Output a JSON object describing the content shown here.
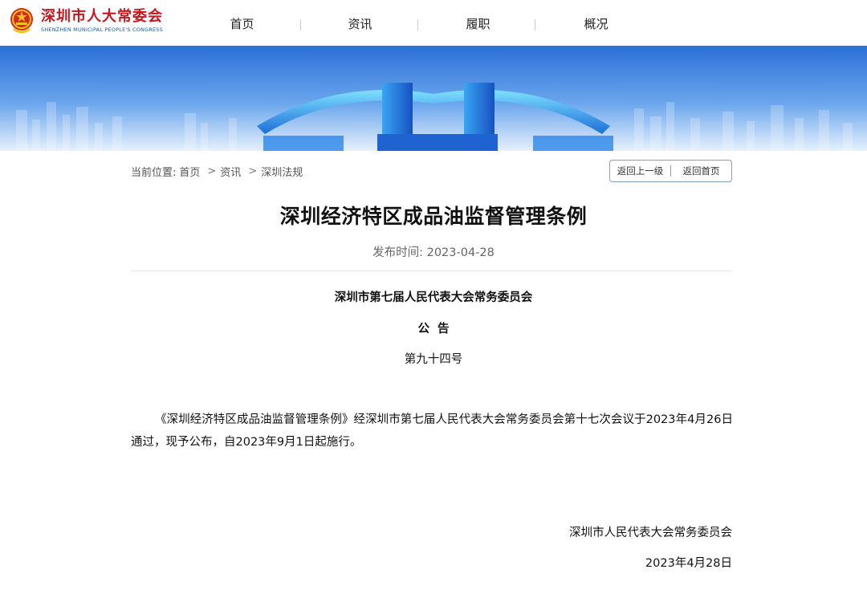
{
  "header": {
    "logo_cn": "深圳市人大常委会",
    "logo_en": "SHENZHEN MUNICIPAL PEOPLE'S CONGRESS",
    "nav": [
      "首页",
      "资讯",
      "履职",
      "概况"
    ]
  },
  "breadcrumb": {
    "label": "当前位置:",
    "items": [
      "首页",
      "资讯",
      "深圳法规"
    ],
    "separator": ">"
  },
  "back_buttons": {
    "up": "返回上一级",
    "home": "返回首页"
  },
  "article": {
    "title": "深圳经济特区成品油监督管理条例",
    "date": "发布时间: 2023-04-28",
    "org": "深圳市第七届人民代表大会常务委员会",
    "notice": "公  告",
    "number": "第九十四号",
    "body": "《深圳经济特区成品油监督管理条例》经深圳市第七届人民代表大会常务委员会第十七次会议于2023年4月26日通过，现予公布，自2023年9月1日起施行。",
    "sign_org": "深圳市人民代表大会常务委员会",
    "sign_date": "2023年4月28日"
  },
  "colors": {
    "brand_red": "#c8161d",
    "brand_blue": "#1a5aa8",
    "banner_top": "#2d76de",
    "banner_bottom": "#eaf3ff"
  },
  "icons": {
    "logo": "national-emblem-icon"
  }
}
